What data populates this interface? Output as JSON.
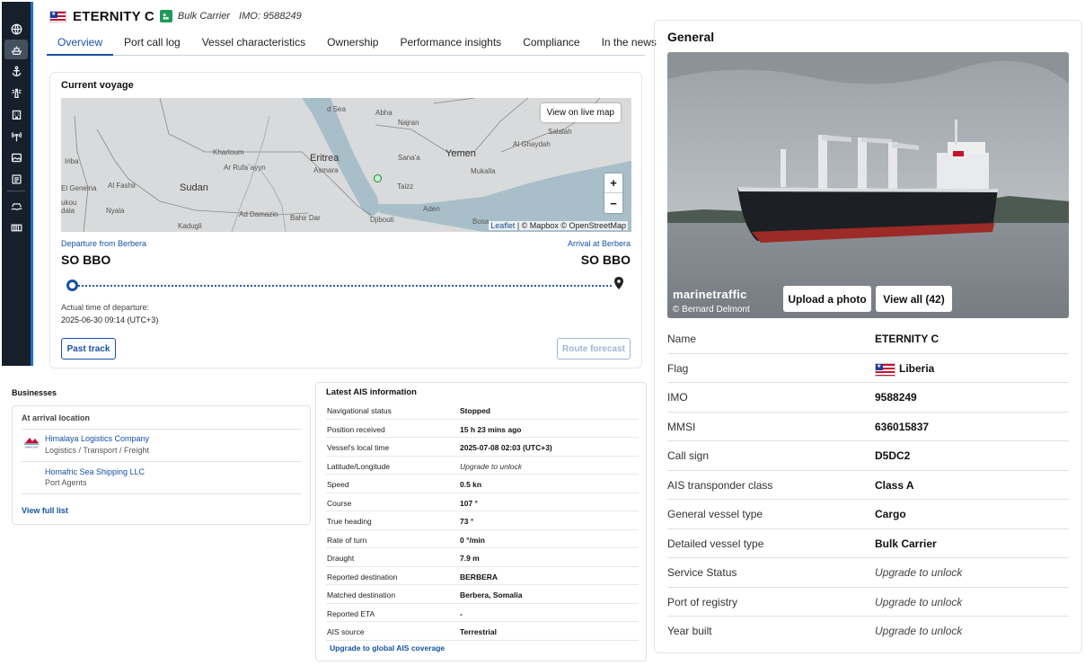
{
  "header": {
    "vessel_name": "ETERNITY C",
    "vessel_type": "Bulk Carrier",
    "imo_text": "IMO: 9588249"
  },
  "sidebar": {
    "icons": [
      "globe-icon",
      "ship-icon",
      "anchor-icon",
      "lighthouse-icon",
      "building-icon",
      "antenna-icon",
      "photo-icon",
      "news-icon",
      "ship-wave-icon",
      "container-icon"
    ]
  },
  "tabs": [
    "Overview",
    "Port call log",
    "Vessel characteristics",
    "Ownership",
    "Performance insights",
    "Compliance",
    "In the news"
  ],
  "voyage": {
    "title": "Current voyage",
    "view_live_map": "View on live map",
    "attribution_leaflet": "Leaflet",
    "attribution_rest": " | © Mapbox © OpenStreetMap",
    "map_labels": {
      "sudan": "Sudan",
      "yemen": "Yemen",
      "eritrea": "Eritrea",
      "khartoum": "Khartoum",
      "ar_rufa": "Ar Rufa`ayyn",
      "asmara": "Asmara",
      "sanaa": "Sana'a",
      "taizz": "Taizz",
      "aden": "Aden",
      "djibouti": "Djibouti",
      "abha": "Abha",
      "najran": "Najran",
      "salalah": "Salalah",
      "alghaydah": "Al Ghaydah",
      "mukalla": "Mukalla",
      "iriba": "Iriba",
      "elgeneina": "El Geneina",
      "alfashir": "Al Fashir",
      "nyala": "Nyala",
      "kadugli": "Kadugli",
      "addamazin": "Ad Damazin",
      "bahirdar": "Bahir Dar",
      "bosaso": "Bosa",
      "redsea": "d Sea",
      "zukou": "ukou",
      "ndala": "dala"
    },
    "departure_label": "Departure from Berbera",
    "arrival_label": "Arrival at Berbera",
    "departure_code": "SO BBO",
    "arrival_code": "SO BBO",
    "atd_label": "Actual time of departure:",
    "atd_value": "2025-06-30 09:14 (UTC+3)",
    "past_track": "Past track",
    "route_forecast": "Route forecast"
  },
  "businesses": {
    "title": "Businesses",
    "subtitle": "At arrival location",
    "items": [
      {
        "name": "Himalaya Logistics Company",
        "type": "Logistics / Transport / Freight",
        "logo_text": "HIMALAYA"
      },
      {
        "name": "Homafric Sea Shipping LLC",
        "type": "Port Agents"
      }
    ],
    "view_full": "View full list"
  },
  "ais": {
    "title": "Latest AIS information",
    "rows": [
      {
        "k": "Navigational status",
        "v": "Stopped"
      },
      {
        "k": "Position received",
        "v": "15 h 23 mins ago"
      },
      {
        "k": "Vessel's local time",
        "v": "2025-07-08 02:03 (UTC+3)"
      },
      {
        "k": "Latitude/Longitude",
        "v": "Upgrade to unlock"
      },
      {
        "k": "Speed",
        "v": "0.5 kn"
      },
      {
        "k": "Course",
        "v": "107 °"
      },
      {
        "k": "True heading",
        "v": "73 °"
      },
      {
        "k": "Rate of turn",
        "v": "0 °/min"
      },
      {
        "k": "Draught",
        "v": "7.9 m"
      },
      {
        "k": "Reported destination",
        "v": "BERBERA"
      },
      {
        "k": "Matched destination",
        "v": "Berbera, Somalia"
      },
      {
        "k": "Reported ETA",
        "v": "-"
      },
      {
        "k": "AIS source",
        "v": "Terrestrial"
      }
    ],
    "upgrade_link": "Upgrade to global AIS coverage"
  },
  "general": {
    "title": "General",
    "photo_brand": "marinetraffic",
    "photo_credit": "© Bernard Delmont",
    "upload_photo": "Upload a photo",
    "view_all": "View all (42)",
    "rows": [
      {
        "k": "Name",
        "v": "ETERNITY C"
      },
      {
        "k": "Flag",
        "v": "Liberia"
      },
      {
        "k": "IMO",
        "v": "9588249"
      },
      {
        "k": "MMSI",
        "v": "636015837"
      },
      {
        "k": "Call sign",
        "v": "D5DC2"
      },
      {
        "k": "AIS transponder class",
        "v": "Class A"
      },
      {
        "k": "General vessel type",
        "v": "Cargo"
      },
      {
        "k": "Detailed vessel type",
        "v": "Bulk Carrier"
      },
      {
        "k": "Service Status",
        "v": "Upgrade to unlock"
      },
      {
        "k": "Port of registry",
        "v": "Upgrade to unlock"
      },
      {
        "k": "Year built",
        "v": "Upgrade to unlock"
      }
    ]
  },
  "colors": {
    "accent": "#1552a3",
    "sidebar": "#16202a",
    "verified": "#1d9a56",
    "liberia_red": "#c8102e",
    "liberia_blue": "#1f3a93"
  }
}
